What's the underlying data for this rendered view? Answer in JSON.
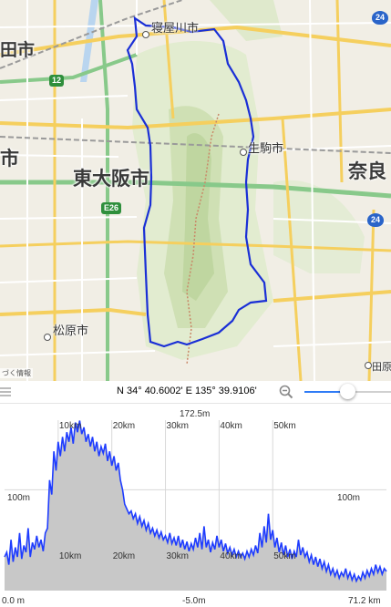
{
  "map": {
    "labels": {
      "neyagawa": "寝屋川市",
      "ikoma": "生駒市",
      "higashiosaka": "東大阪市",
      "nara": "奈良",
      "matsubara": "松原市",
      "takada": "田原",
      "left_city": "田市",
      "left_edge": "市"
    },
    "routes": {
      "r12": "12",
      "e26": "E26",
      "r24": "24",
      "r24b": "24"
    },
    "credit": "づく情報",
    "colors": {
      "route_line": "#1a2fd6",
      "mountain": "#cfe0b4",
      "road_yellow": "#f7d46b",
      "highway": "#7fc97a"
    }
  },
  "toolbar": {
    "coords": "N 34° 40.6002' E 135° 39.9106'",
    "zoom_level": 0.5
  },
  "profile": {
    "max_label": "172.5m",
    "mid_label_left": "100m",
    "mid_label_right": "100m",
    "start_label": "0.0 m",
    "min_label": "-5.0m",
    "end_label": "71.2 km",
    "distance_ticks_top": [
      "10km",
      "20km",
      "30km",
      "40km",
      "50km"
    ],
    "distance_ticks_bottom": [
      "10km",
      "20km",
      "30km",
      "40km",
      "50km"
    ],
    "colors": {
      "line": "#1e3cff",
      "fill": "#c8c8c8",
      "grid": "#d8d8d8"
    },
    "elevation_points": [
      [
        0,
        30
      ],
      [
        0.4,
        35
      ],
      [
        0.8,
        22
      ],
      [
        1.2,
        48
      ],
      [
        1.6,
        25
      ],
      [
        2.0,
        40
      ],
      [
        2.4,
        30
      ],
      [
        2.8,
        55
      ],
      [
        3.2,
        28
      ],
      [
        3.6,
        42
      ],
      [
        4.0,
        35
      ],
      [
        4.4,
        60
      ],
      [
        4.8,
        30
      ],
      [
        5.2,
        45
      ],
      [
        5.6,
        38
      ],
      [
        6.0,
        52
      ],
      [
        6.4,
        40
      ],
      [
        6.8,
        48
      ],
      [
        7.2,
        36
      ],
      [
        7.6,
        55
      ],
      [
        8.0,
        60
      ],
      [
        8.4,
        110
      ],
      [
        8.8,
        95
      ],
      [
        9.2,
        140
      ],
      [
        9.6,
        120
      ],
      [
        10.0,
        150
      ],
      [
        10.4,
        135
      ],
      [
        10.8,
        155
      ],
      [
        11.2,
        140
      ],
      [
        11.6,
        160
      ],
      [
        12.0,
        150
      ],
      [
        12.4,
        165
      ],
      [
        12.8,
        148
      ],
      [
        13.2,
        170
      ],
      [
        13.6,
        160
      ],
      [
        14.0,
        172
      ],
      [
        14.4,
        158
      ],
      [
        14.8,
        165
      ],
      [
        15.2,
        150
      ],
      [
        15.6,
        158
      ],
      [
        16.0,
        145
      ],
      [
        16.4,
        155
      ],
      [
        16.8,
        140
      ],
      [
        17.2,
        150
      ],
      [
        17.6,
        135
      ],
      [
        18.0,
        145
      ],
      [
        18.4,
        138
      ],
      [
        18.8,
        148
      ],
      [
        19.2,
        130
      ],
      [
        19.6,
        140
      ],
      [
        20.0,
        125
      ],
      [
        20.4,
        135
      ],
      [
        20.8,
        120
      ],
      [
        21.2,
        128
      ],
      [
        21.6,
        110
      ],
      [
        22.0,
        100
      ],
      [
        22.4,
        85
      ],
      [
        22.8,
        80
      ],
      [
        23.2,
        75
      ],
      [
        23.6,
        78
      ],
      [
        24.0,
        70
      ],
      [
        24.4,
        75
      ],
      [
        24.8,
        65
      ],
      [
        25.2,
        72
      ],
      [
        25.6,
        62
      ],
      [
        26.0,
        68
      ],
      [
        26.4,
        58
      ],
      [
        26.8,
        65
      ],
      [
        27.2,
        55
      ],
      [
        27.6,
        60
      ],
      [
        28.0,
        52
      ],
      [
        28.4,
        58
      ],
      [
        28.8,
        50
      ],
      [
        29.2,
        56
      ],
      [
        29.6,
        48
      ],
      [
        30.0,
        52
      ],
      [
        30.4,
        45
      ],
      [
        30.8,
        55
      ],
      [
        31.2,
        44
      ],
      [
        31.6,
        50
      ],
      [
        32.0,
        42
      ],
      [
        32.4,
        52
      ],
      [
        32.8,
        40
      ],
      [
        33.2,
        48
      ],
      [
        33.6,
        38
      ],
      [
        34.0,
        46
      ],
      [
        34.4,
        36
      ],
      [
        34.8,
        44
      ],
      [
        35.2,
        38
      ],
      [
        35.6,
        50
      ],
      [
        36.0,
        40
      ],
      [
        36.4,
        55
      ],
      [
        36.8,
        38
      ],
      [
        37.2,
        62
      ],
      [
        37.6,
        40
      ],
      [
        38.0,
        48
      ],
      [
        38.4,
        35
      ],
      [
        38.8,
        45
      ],
      [
        39.2,
        38
      ],
      [
        39.6,
        52
      ],
      [
        40.0,
        40
      ],
      [
        40.4,
        48
      ],
      [
        40.8,
        36
      ],
      [
        41.2,
        44
      ],
      [
        41.6,
        34
      ],
      [
        42.0,
        40
      ],
      [
        42.4,
        32
      ],
      [
        42.8,
        38
      ],
      [
        43.2,
        30
      ],
      [
        43.6,
        36
      ],
      [
        44.0,
        30
      ],
      [
        44.4,
        34
      ],
      [
        44.8,
        28
      ],
      [
        45.2,
        36
      ],
      [
        45.6,
        30
      ],
      [
        46.0,
        38
      ],
      [
        46.4,
        32
      ],
      [
        46.8,
        42
      ],
      [
        47.2,
        34
      ],
      [
        47.6,
        55
      ],
      [
        48.0,
        40
      ],
      [
        48.4,
        62
      ],
      [
        48.8,
        45
      ],
      [
        49.2,
        75
      ],
      [
        49.6,
        48
      ],
      [
        50.0,
        58
      ],
      [
        50.4,
        40
      ],
      [
        50.8,
        50
      ],
      [
        51.2,
        35
      ],
      [
        51.6,
        45
      ],
      [
        52.0,
        32
      ],
      [
        52.4,
        42
      ],
      [
        52.8,
        30
      ],
      [
        53.2,
        38
      ],
      [
        53.6,
        28
      ],
      [
        54.0,
        36
      ],
      [
        54.4,
        30
      ],
      [
        54.8,
        48
      ],
      [
        55.2,
        32
      ],
      [
        55.6,
        40
      ],
      [
        56.0,
        30
      ],
      [
        56.4,
        35
      ],
      [
        56.8,
        25
      ],
      [
        57.2,
        32
      ],
      [
        57.6,
        22
      ],
      [
        58.0,
        30
      ],
      [
        58.4,
        20
      ],
      [
        58.8,
        28
      ],
      [
        59.2,
        18
      ],
      [
        59.6,
        25
      ],
      [
        60.0,
        15
      ],
      [
        60.4,
        22
      ],
      [
        60.8,
        12
      ],
      [
        61.2,
        18
      ],
      [
        61.6,
        10
      ],
      [
        62.0,
        16
      ],
      [
        62.4,
        8
      ],
      [
        62.8,
        14
      ],
      [
        63.2,
        10
      ],
      [
        63.6,
        18
      ],
      [
        64.0,
        8
      ],
      [
        64.4,
        14
      ],
      [
        64.8,
        6
      ],
      [
        65.2,
        12
      ],
      [
        65.6,
        5
      ],
      [
        66.0,
        10
      ],
      [
        66.4,
        6
      ],
      [
        66.8,
        14
      ],
      [
        67.2,
        8
      ],
      [
        67.6,
        16
      ],
      [
        68.0,
        10
      ],
      [
        68.4,
        18
      ],
      [
        68.8,
        12
      ],
      [
        69.2,
        22
      ],
      [
        69.6,
        14
      ],
      [
        70.0,
        20
      ],
      [
        70.4,
        12
      ],
      [
        70.8,
        18
      ],
      [
        71.2,
        15
      ]
    ],
    "x_range_km": [
      0,
      71.2
    ],
    "y_range_m": [
      -5.0,
      172.5
    ]
  }
}
